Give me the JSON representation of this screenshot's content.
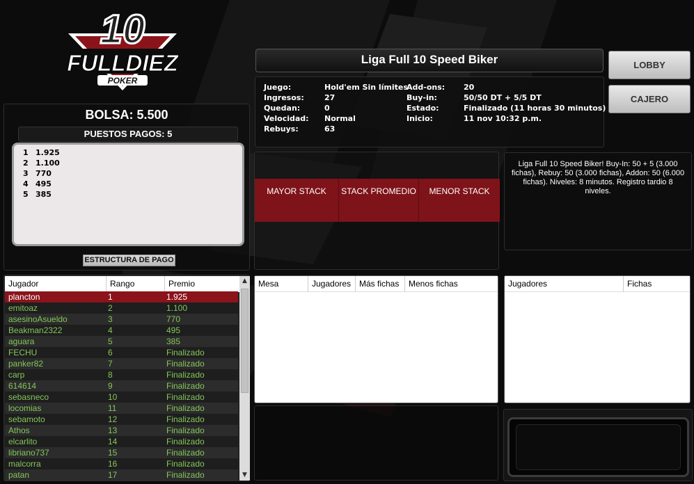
{
  "logo": {
    "number": "10",
    "brand": "FULLDIEZ",
    "sub": "POKER"
  },
  "bolsa": {
    "title": "BOLSA: 5.500",
    "puestos_label": "PUESTOS PAGOS: 5",
    "payouts": [
      {
        "pos": "1",
        "amount": "1.925"
      },
      {
        "pos": "2",
        "amount": "1.100"
      },
      {
        "pos": "3",
        "amount": "770"
      },
      {
        "pos": "4",
        "amount": "495"
      },
      {
        "pos": "5",
        "amount": "385"
      }
    ],
    "estructura_label": "ESTRUCTURA DE PAGO"
  },
  "tournament": {
    "title": "Liga Full 10 Speed Biker",
    "info_left": [
      {
        "label": "Juego:",
        "value": "Hold'em Sin límites"
      },
      {
        "label": "Ingresos:",
        "value": "27"
      },
      {
        "label": "Quedan:",
        "value": "0"
      },
      {
        "label": "Velocidad:",
        "value": "Normal"
      },
      {
        "label": "Rebuys:",
        "value": "63"
      }
    ],
    "info_right": [
      {
        "label": "Add-ons:",
        "value": "20"
      },
      {
        "label": "Buy-in:",
        "value": "50/50 DT + 5/5 DT"
      },
      {
        "label": "Estado:",
        "value": "Finalizado (11 horas 30 minutos)"
      },
      {
        "label": "Inicio:",
        "value": "11 nov 10:32 p.m."
      }
    ]
  },
  "buttons": {
    "lobby": "LOBBY",
    "cajero": "CAJERO"
  },
  "stacks": {
    "mayor": "MAYOR STACK",
    "promedio": "STACK PROMEDIO",
    "menor": "MENOR STACK"
  },
  "description": "Liga Full 10 Speed Biker! Buy-In: 50 + 5 (3.000 fichas), Rebuy: 50 (3.000 fichas), Addon: 50 (6.000 fichas). Niveles: 8 minutos. Registro tardio 8 niveles.",
  "players_table": {
    "headers": {
      "jugador": "Jugador",
      "rango": "Rango",
      "premio": "Premio"
    },
    "rows": [
      {
        "name": "plancton",
        "rank": "1",
        "prize": "1.925"
      },
      {
        "name": "emitoaz",
        "rank": "2",
        "prize": "1.100"
      },
      {
        "name": "asesinoAsueldo",
        "rank": "3",
        "prize": "770"
      },
      {
        "name": "Beakman2322",
        "rank": "4",
        "prize": "495"
      },
      {
        "name": "aguara",
        "rank": "5",
        "prize": "385"
      },
      {
        "name": "FECHU",
        "rank": "6",
        "prize": "Finalizado"
      },
      {
        "name": "panker82",
        "rank": "7",
        "prize": "Finalizado"
      },
      {
        "name": "carp",
        "rank": "8",
        "prize": "Finalizado"
      },
      {
        "name": "614614",
        "rank": "9",
        "prize": "Finalizado"
      },
      {
        "name": "sebasneco",
        "rank": "10",
        "prize": "Finalizado"
      },
      {
        "name": "locomias",
        "rank": "11",
        "prize": "Finalizado"
      },
      {
        "name": "sebamoto",
        "rank": "12",
        "prize": "Finalizado"
      },
      {
        "name": "Athos",
        "rank": "13",
        "prize": "Finalizado"
      },
      {
        "name": "elcarlito",
        "rank": "14",
        "prize": "Finalizado"
      },
      {
        "name": "libriano737",
        "rank": "15",
        "prize": "Finalizado"
      },
      {
        "name": "malcorra",
        "rank": "16",
        "prize": "Finalizado"
      },
      {
        "name": "patan",
        "rank": "17",
        "prize": "Finalizado"
      }
    ]
  },
  "mesa_table": {
    "headers": {
      "mesa": "Mesa",
      "jugadores": "Jugadores",
      "mas": "Más fichas",
      "menos": "Menos fichas"
    }
  },
  "table_players": {
    "headers": {
      "jugadores": "Jugadores",
      "fichas": "Fichas"
    }
  },
  "colors": {
    "accent": "#8b141b",
    "green_text": "#84c65b",
    "background": "#0c0c0c"
  }
}
